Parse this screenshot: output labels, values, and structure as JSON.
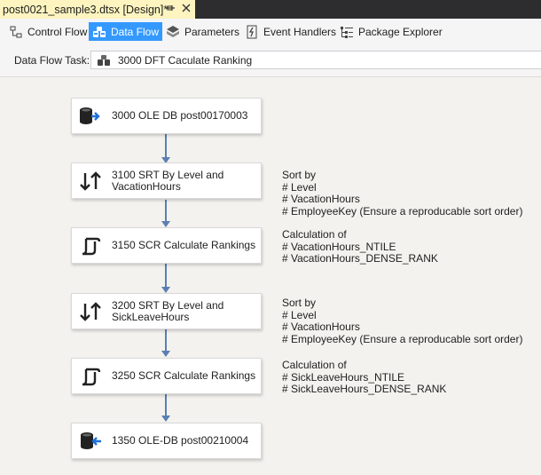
{
  "document_tab": {
    "title": "post0021_sample3.dtsx [Design]*"
  },
  "designer_tabs": [
    {
      "label": "Control Flow",
      "icon": "control-flow-icon",
      "active": false
    },
    {
      "label": "Data Flow",
      "icon": "data-flow-icon",
      "active": true
    },
    {
      "label": "Parameters",
      "icon": "parameters-icon",
      "active": false
    },
    {
      "label": "Event Handlers",
      "icon": "event-handlers-icon",
      "active": false
    },
    {
      "label": "Package Explorer",
      "icon": "package-explorer-icon",
      "active": false
    }
  ],
  "task": {
    "label": "Data Flow Task:",
    "value": "3000 DFT Caculate Ranking"
  },
  "components": [
    {
      "label_line1": "3000 OLE DB post00170003",
      "label_line2": "",
      "icon": "ole-db-source-icon"
    },
    {
      "label_line1": "3100 SRT By Level and",
      "label_line2": "VacationHours",
      "icon": "sort-icon"
    },
    {
      "label_line1": "3150 SCR Calculate Rankings",
      "label_line2": "",
      "icon": "script-component-icon"
    },
    {
      "label_line1": "3200 SRT By Level and",
      "label_line2": "SickLeaveHours",
      "icon": "sort-icon"
    },
    {
      "label_line1": "3250 SCR Calculate Rankings",
      "label_line2": "",
      "icon": "script-component-icon"
    },
    {
      "label_line1": "1350 OLE-DB post00210004",
      "label_line2": "",
      "icon": "ole-db-destination-icon"
    }
  ],
  "annotations": [
    {
      "lines": [
        "Sort by",
        "# Level",
        "# VacationHours",
        "# EmployeeKey (Ensure a reproducable sort order)"
      ]
    },
    {
      "lines": [
        "Calculation of",
        "# VacationHours_NTILE",
        "# VacationHours_DENSE_RANK"
      ]
    },
    {
      "lines": [
        "Sort by",
        "# Level",
        "# VacationHours",
        "# EmployeeKey (Ensure a reproducable sort order)"
      ]
    },
    {
      "lines": [
        "Calculation of",
        "# SickLeaveHours_NTILE",
        "# SickLeaveHours_DENSE_RANK"
      ]
    }
  ],
  "colors": {
    "active_tab": "#3399ff",
    "document_tab": "#fdf4bf",
    "connector": "#5a7fb5",
    "canvas": "#f4f2ee"
  }
}
